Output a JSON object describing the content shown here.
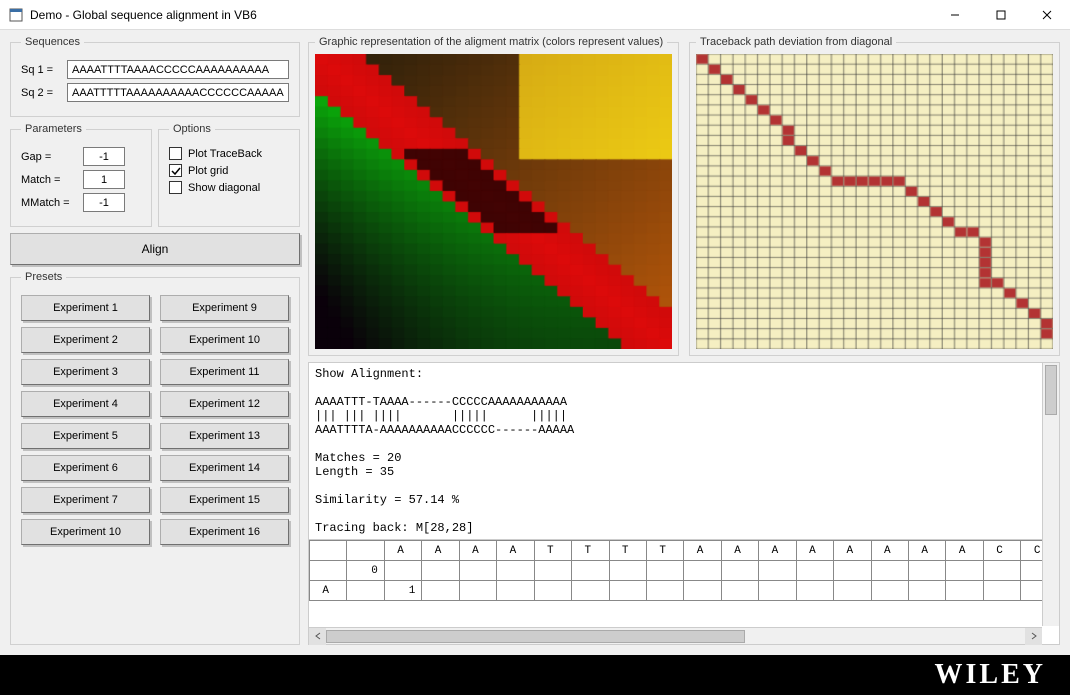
{
  "window": {
    "title": "Demo - Global sequence alignment in VB6",
    "icon": "form-icon"
  },
  "sequences": {
    "legend": "Sequences",
    "sq1_label": "Sq 1 =",
    "sq1_value": "AAAATTTTAAAACCCCCAAAAAAAAAA",
    "sq2_label": "Sq 2 =",
    "sq2_value": "AAATTTTTAAAAAAAAAACCCCCCAAAAA"
  },
  "parameters": {
    "legend": "Parameters",
    "gap_label": "Gap =",
    "gap_value": "-1",
    "match_label": "Match =",
    "match_value": "1",
    "mmatch_label": "MMatch =",
    "mmatch_value": "-1"
  },
  "options": {
    "legend": "Options",
    "plot_traceback": {
      "label": "Plot TraceBack",
      "checked": false
    },
    "plot_grid": {
      "label": "Plot grid",
      "checked": true
    },
    "show_diagonal": {
      "label": "Show diagonal",
      "checked": false
    }
  },
  "align_button": "Align",
  "presets": {
    "legend": "Presets",
    "col1": [
      "Experiment 1",
      "Experiment 2",
      "Experiment 3",
      "Experiment 4",
      "Experiment 5",
      "Experiment 6",
      "Experiment 7",
      "Experiment 10"
    ],
    "col2": [
      "Experiment 9",
      "Experiment 10",
      "Experiment 11",
      "Experiment 12",
      "Experiment 13",
      "Experiment 14",
      "Experiment 15",
      "Experiment 16"
    ]
  },
  "graphic_matrix_legend": "Graphic representation of the aligment matrix (colors represent values)",
  "traceback_legend": "Traceback path deviation from diagonal",
  "traceback_path": [
    [
      0,
      0
    ],
    [
      1,
      1
    ],
    [
      2,
      2
    ],
    [
      3,
      3
    ],
    [
      4,
      4
    ],
    [
      5,
      5
    ],
    [
      6,
      6
    ],
    [
      7,
      7
    ],
    [
      8,
      7
    ],
    [
      9,
      8
    ],
    [
      10,
      9
    ],
    [
      11,
      10
    ],
    [
      12,
      11
    ],
    [
      12,
      12
    ],
    [
      12,
      13
    ],
    [
      12,
      14
    ],
    [
      12,
      15
    ],
    [
      12,
      16
    ],
    [
      13,
      17
    ],
    [
      14,
      18
    ],
    [
      15,
      19
    ],
    [
      16,
      20
    ],
    [
      17,
      21
    ],
    [
      17,
      22
    ],
    [
      18,
      23
    ],
    [
      19,
      23
    ],
    [
      20,
      23
    ],
    [
      21,
      23
    ],
    [
      22,
      23
    ],
    [
      22,
      24
    ],
    [
      23,
      25
    ],
    [
      24,
      26
    ],
    [
      25,
      27
    ],
    [
      26,
      28
    ],
    [
      27,
      28
    ]
  ],
  "output": {
    "header": "Show Alignment:",
    "line1": "AAAATTT-TAAAA------CCCCCAAAAAAAAAAA",
    "line2": "||| ||| ||||       |||||      |||||",
    "line3": "AAATTTTA-AAAAAAAAAACCCCCC------AAAAA",
    "matches": "Matches = 20",
    "length": "Length = 35",
    "similarity": "Similarity = 57.14 %",
    "tracing": "Tracing back: M[28,28]",
    "matrix_header": [
      "",
      "",
      "A",
      "A",
      "A",
      "A",
      "T",
      "T",
      "T",
      "T",
      "A",
      "A",
      "A",
      "A",
      "A",
      "A",
      "A",
      "A",
      "C",
      "C"
    ],
    "matrix_rows": [
      [
        "",
        "0",
        "",
        "",
        "",
        "",
        "",
        "",
        "",
        "",
        "",
        "",
        "",
        "",
        "",
        "",
        "",
        "",
        "",
        ""
      ],
      [
        "A",
        "",
        "1",
        "",
        "",
        "",
        "",
        "",
        "",
        "",
        "",
        "",
        "",
        "",
        "",
        "",
        "",
        "",
        "",
        ""
      ]
    ]
  },
  "footer_brand": "WILEY"
}
